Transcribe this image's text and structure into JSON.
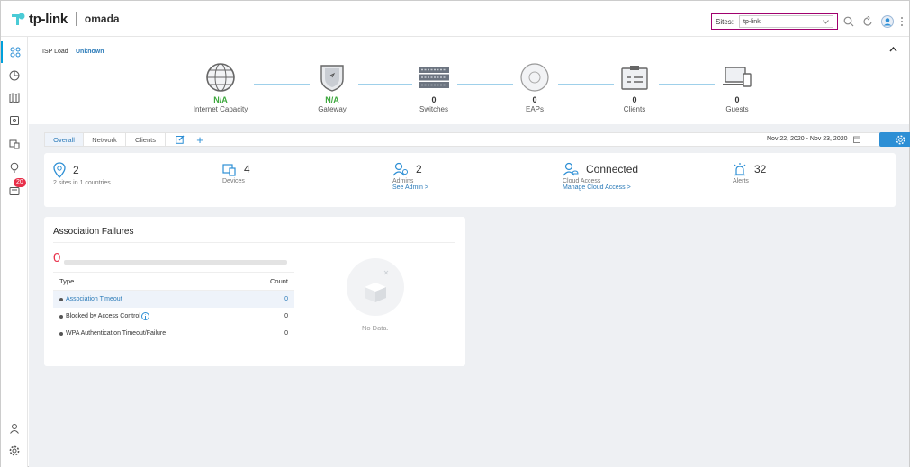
{
  "topbar": {
    "brand": "tp-link",
    "product": "omada",
    "sites_label": "Sites:",
    "sites_value": "tp-link"
  },
  "sidebar": {
    "alerts_badge": "20"
  },
  "topology": {
    "isp_label": "ISP Load",
    "isp_value": "Unknown",
    "nodes": [
      {
        "value": "N/A",
        "label": "Internet Capacity"
      },
      {
        "value": "N/A",
        "label": "Gateway"
      },
      {
        "value": "0",
        "label": "Switches"
      },
      {
        "value": "0",
        "label": "EAPs"
      },
      {
        "value": "0",
        "label": "Clients"
      },
      {
        "value": "0",
        "label": "Guests"
      }
    ]
  },
  "tabs": {
    "overall": "Overall",
    "network": "Network",
    "clients": "Clients",
    "add": "+",
    "date_range": "Nov 22, 2020 - Nov 23, 2020"
  },
  "summary": {
    "sites": {
      "value": "2",
      "sub": "2 sites in 1 countries"
    },
    "devices": {
      "value": "4",
      "sub": "Devices"
    },
    "admins": {
      "value": "2",
      "sub": "Admins",
      "link": "See Admin >"
    },
    "cloud": {
      "value": "Connected",
      "sub": "Cloud Access",
      "link": "Manage Cloud Access >"
    },
    "alerts": {
      "value": "32",
      "sub": "Alerts"
    }
  },
  "association": {
    "title": "Association Failures",
    "total": "0",
    "col_type": "Type",
    "col_count": "Count",
    "rows": [
      {
        "type": "Association Timeout",
        "count": "0"
      },
      {
        "type": "Blocked by Access Control",
        "count": "0"
      },
      {
        "type": "WPA Authentication Timeout/Failure",
        "count": "0"
      }
    ],
    "no_data": "No Data."
  },
  "colors": {
    "accent": "#2d8fd5",
    "alert": "#e8304a",
    "ok": "#3ea83e",
    "sites_border": "#a0006e"
  }
}
